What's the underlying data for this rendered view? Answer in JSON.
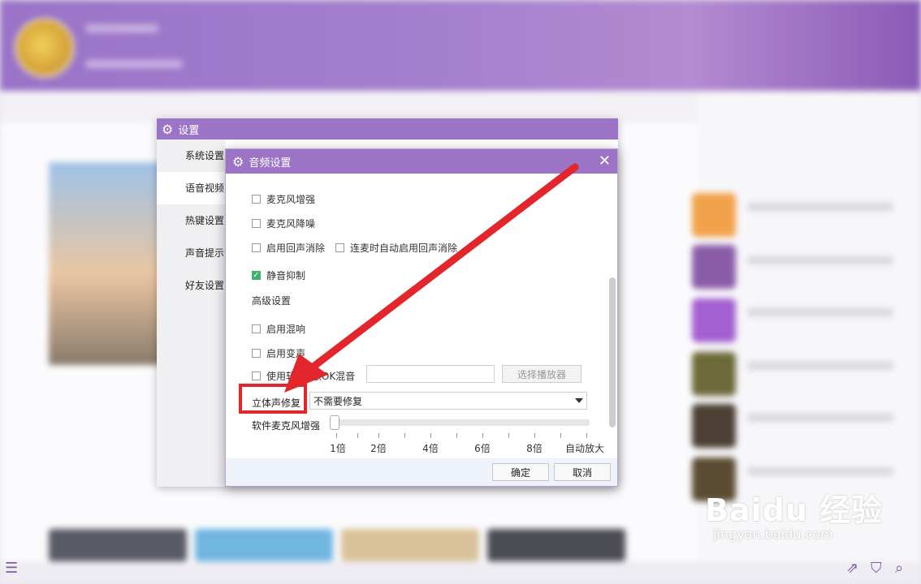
{
  "settings_window": {
    "title": "设置",
    "nav": [
      "系统设置",
      "语音视频",
      "热键设置",
      "声音提示",
      "好友设置"
    ]
  },
  "audio_dialog": {
    "title": "音频设置",
    "close": "✕",
    "options": [
      {
        "label": "麦克风增强",
        "checked": false
      },
      {
        "label": "麦克风降噪",
        "checked": false
      },
      {
        "label": "启用回声消除",
        "checked": false
      },
      {
        "label": "连麦时自动启用回声消除",
        "checked": false
      },
      {
        "label": "静音抑制",
        "checked": true
      }
    ],
    "advanced_title": "高级设置",
    "advanced_options": [
      {
        "label": "启用混响",
        "checked": false
      },
      {
        "label": "启用变声",
        "checked": false
      },
      {
        "label": "使用软件K歌OK混音",
        "checked": false
      }
    ],
    "select_player_button": "选择播放器",
    "stereo_label": "立体声修复",
    "stereo_value": "不需要修复",
    "mic_boost_label": "软件麦克风增强",
    "mic_boost_ticks": [
      "1倍",
      "2倍",
      "4倍",
      "6倍",
      "8倍",
      "自动放大"
    ],
    "mic_boost_value": "1倍",
    "ok_button": "确定",
    "cancel_button": "取消"
  },
  "annotation": {
    "color": "#e2262b"
  },
  "watermark": {
    "main": "Baidu 经验",
    "sub": "jingyan.baidu.com"
  },
  "colors": {
    "accent": "#9b74c6",
    "checked": "#3fb16a"
  }
}
